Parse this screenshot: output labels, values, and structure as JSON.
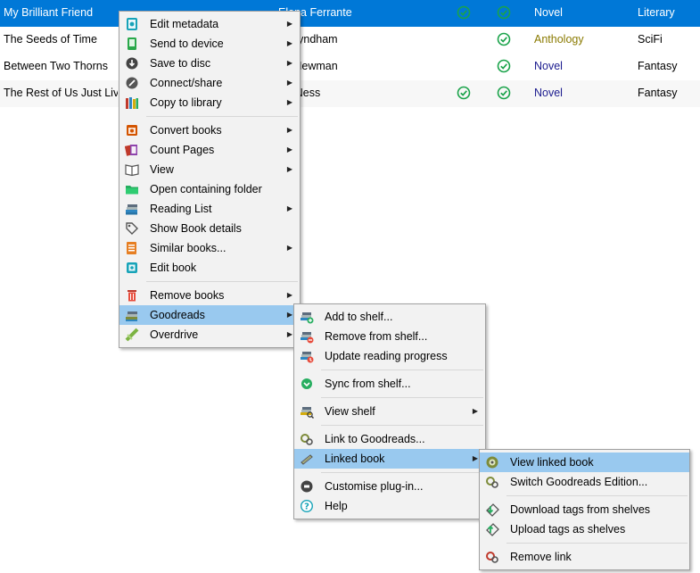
{
  "books": [
    {
      "title": "My Brilliant Friend",
      "author": "Elena Ferrante",
      "check1": true,
      "check2": true,
      "genre": "Novel",
      "category": "Literary",
      "selected": true
    },
    {
      "title": "The Seeds of Time",
      "author": "n Wyndham",
      "check1": false,
      "check2": true,
      "genre": "Anthology",
      "category": "SciFi",
      "selected": false
    },
    {
      "title": "Between Two Thorns",
      "author": "na Newman",
      "check1": false,
      "check2": true,
      "genre": "Novel",
      "category": "Fantasy",
      "selected": false
    },
    {
      "title": "The Rest of Us Just Liv",
      "author": "ick Ness",
      "check1": true,
      "check2": true,
      "genre": "Novel",
      "category": "Fantasy",
      "selected": false
    }
  ],
  "colors": {
    "selection": "#0078d7",
    "menu_highlight": "#99c9ef",
    "check_green": "#1aa34a"
  },
  "main_menu": {
    "items": [
      {
        "label": "Edit metadata",
        "icon": "edit-metadata-icon",
        "submenu": true
      },
      {
        "label": "Send to device",
        "icon": "device-icon",
        "submenu": true
      },
      {
        "label": "Save to disc",
        "icon": "save-icon",
        "submenu": true
      },
      {
        "label": "Connect/share",
        "icon": "connect-icon",
        "submenu": true
      },
      {
        "label": "Copy to library",
        "icon": "library-icon",
        "submenu": true
      },
      {
        "label": "Convert books",
        "icon": "convert-icon",
        "submenu": true
      },
      {
        "label": "Count Pages",
        "icon": "count-pages-icon",
        "submenu": true
      },
      {
        "label": "View",
        "icon": "view-book-icon",
        "submenu": true
      },
      {
        "label": "Open containing folder",
        "icon": "folder-icon",
        "submenu": false
      },
      {
        "label": "Reading List",
        "icon": "reading-list-icon",
        "submenu": true
      },
      {
        "label": "Show Book details",
        "icon": "tag-icon",
        "submenu": false
      },
      {
        "label": "Similar books...",
        "icon": "similar-books-icon",
        "submenu": true
      },
      {
        "label": "Edit book",
        "icon": "edit-book-icon",
        "submenu": false
      },
      {
        "label": "Remove books",
        "icon": "trash-icon",
        "submenu": true
      },
      {
        "label": "Goodreads",
        "icon": "goodreads-icon",
        "submenu": true
      },
      {
        "label": "Overdrive",
        "icon": "overdrive-icon",
        "submenu": true
      }
    ]
  },
  "goodreads_menu": {
    "items": [
      {
        "label": "Add to shelf...",
        "icon": "add-shelf-icon"
      },
      {
        "label": "Remove from shelf...",
        "icon": "remove-shelf-icon"
      },
      {
        "label": "Update reading progress",
        "icon": "update-progress-icon"
      },
      {
        "label": "Sync from shelf...",
        "icon": "sync-icon"
      },
      {
        "label": "View shelf",
        "icon": "view-shelf-icon",
        "submenu": true
      },
      {
        "label": "Link to Goodreads...",
        "icon": "link-icon"
      },
      {
        "label": "Linked book",
        "icon": "linked-book-icon",
        "submenu": true
      },
      {
        "label": "Customise plug-in...",
        "icon": "customise-icon"
      },
      {
        "label": "Help",
        "icon": "help-icon"
      }
    ]
  },
  "linked_book_menu": {
    "items": [
      {
        "label": "View linked book",
        "icon": "view-linked-icon"
      },
      {
        "label": "Switch Goodreads Edition...",
        "icon": "switch-edition-icon"
      },
      {
        "label": "Download tags from shelves",
        "icon": "download-tags-icon"
      },
      {
        "label": "Upload tags as shelves",
        "icon": "upload-tags-icon"
      },
      {
        "label": "Remove link",
        "icon": "remove-link-icon"
      }
    ]
  }
}
